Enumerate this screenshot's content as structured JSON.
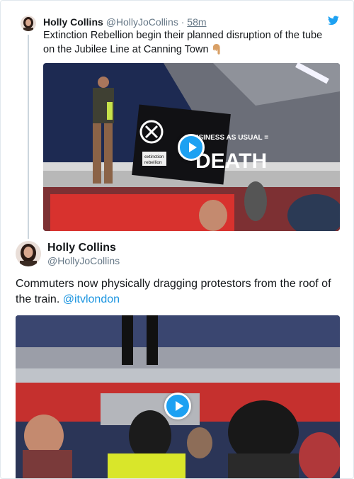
{
  "parent_tweet": {
    "name": "Holly Collins",
    "handle": "@HollyJoCollins",
    "separator": "·",
    "time": "58m",
    "text": "Extinction Rebellion begin their planned disruption of the tube on the Jubilee Line at Canning Town",
    "emoji_icon": "pointing-down-hand-icon",
    "banner_text": [
      "extinction",
      "rebellion",
      "BUSINESS AS USUAL = DEATH"
    ]
  },
  "main_tweet": {
    "name": "Holly Collins",
    "handle": "@HollyJoCollins",
    "text": "Commuters now physically dragging protestors from the roof of the train.",
    "mention": "@itvlondon"
  },
  "icons": {
    "brand": "twitter-bird-icon",
    "play": "play-icon"
  },
  "colors": {
    "brand": "#1da1f2",
    "link": "#1b95e0",
    "secondary_text": "#657786",
    "thread_line": "#ccd6dd",
    "tube_red": "#d8322e"
  }
}
